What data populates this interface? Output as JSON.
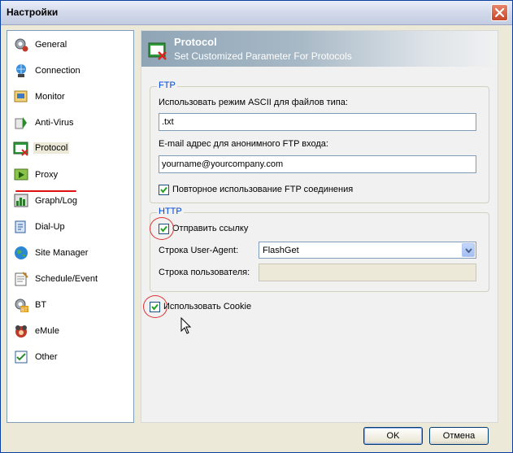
{
  "window": {
    "title": "Настройки"
  },
  "sidebar": {
    "items": [
      {
        "label": "General",
        "icon": "gear-icon"
      },
      {
        "label": "Connection",
        "icon": "connection-icon"
      },
      {
        "label": "Monitor",
        "icon": "monitor-icon"
      },
      {
        "label": "Anti-Virus",
        "icon": "antivirus-icon"
      },
      {
        "label": "Protocol",
        "icon": "protocol-icon"
      },
      {
        "label": "Proxy",
        "icon": "proxy-icon"
      },
      {
        "label": "Graph/Log",
        "icon": "graph-icon"
      },
      {
        "label": "Dial-Up",
        "icon": "dialup-icon"
      },
      {
        "label": "Site Manager",
        "icon": "globe-icon"
      },
      {
        "label": "Schedule/Event",
        "icon": "schedule-icon"
      },
      {
        "label": "BT",
        "icon": "bt-icon"
      },
      {
        "label": "eMule",
        "icon": "emule-icon"
      },
      {
        "label": "Other",
        "icon": "checklist-icon"
      }
    ],
    "active": "Protocol"
  },
  "banner": {
    "title": "Protocol",
    "subtitle": "Set Customized Parameter For Protocols"
  },
  "ftp": {
    "legend": "FTP",
    "ascii_label": "Использовать режим ASCII для файлов типа:",
    "ascii_value": ".txt",
    "email_label": "E-mail адрес для анонимного FTP входа:",
    "email_value": "yourname@yourcompany.com",
    "reuse_label": "Повторное использование FTP соединения",
    "reuse_checked": true
  },
  "http": {
    "legend": "HTTP",
    "send_ref_label": "Отправить ссылку",
    "send_ref_checked": true,
    "user_agent_label": "Строка User-Agent:",
    "user_agent_value": "FlashGet",
    "user_string_label": "Строка пользователя:",
    "user_string_value": ""
  },
  "cookie": {
    "label": "Использовать Cookie",
    "checked": true
  },
  "buttons": {
    "ok": "OK",
    "cancel": "Отмена"
  }
}
